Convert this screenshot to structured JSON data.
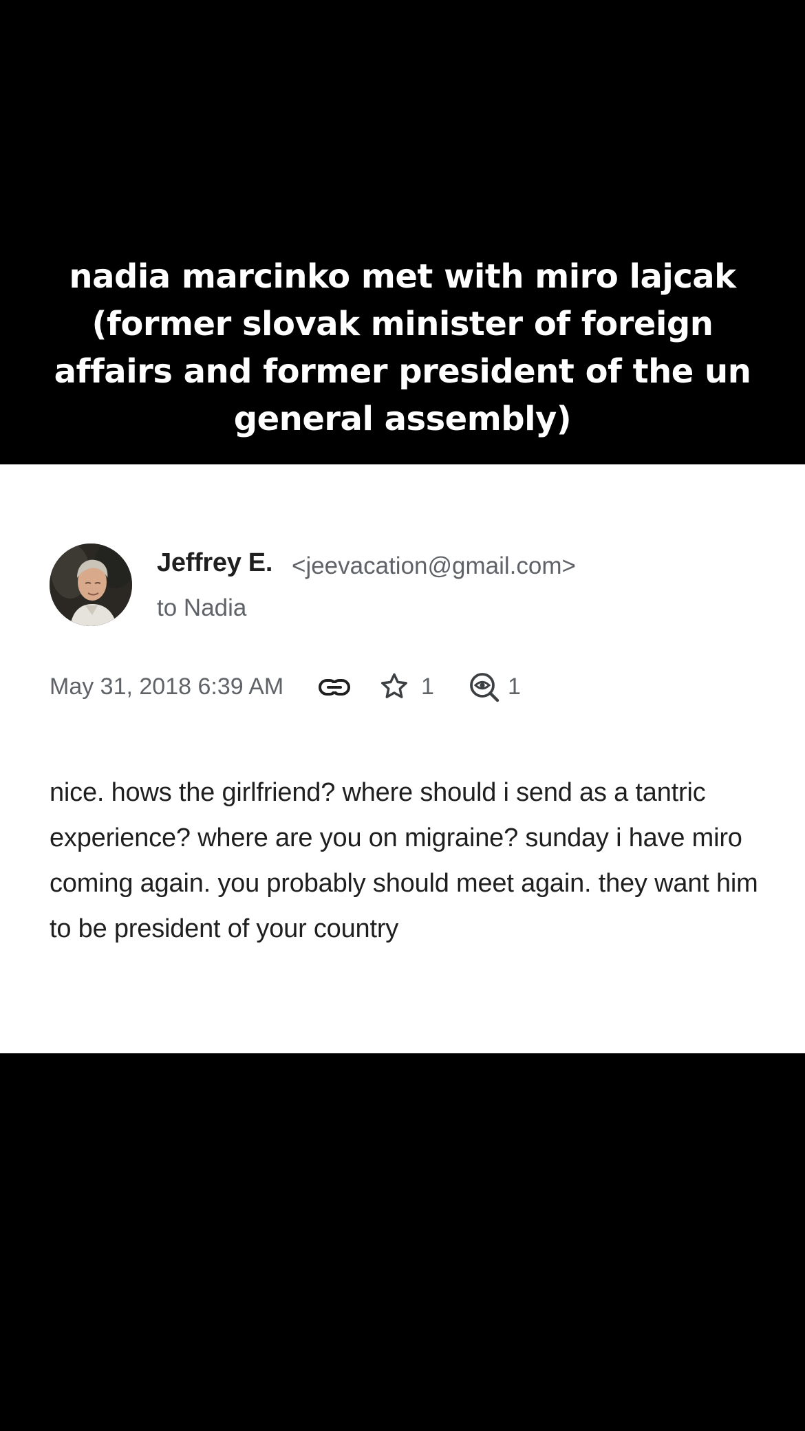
{
  "caption": "nadia marcinko met with miro lajcak (former slovak minister of foreign affairs and former president of the un general assembly)",
  "email": {
    "sender_name": "Jeffrey E.",
    "sender_email": "<jeevacation@gmail.com>",
    "recipient": "to Nadia",
    "date": "May 31, 2018 6:39 AM",
    "star_count": "1",
    "seen_count": "1",
    "body": "nice. hows the girlfriend? where should i send as a tantric experience? where are you on migraine? sunday i have miro coming again. you probably should meet again. they want him to be president of your country"
  },
  "icons": {
    "avatar": "profile-photo",
    "link": "link-icon",
    "star": "star-icon",
    "seen": "eye-search-icon"
  },
  "colors": {
    "background_band": "#000000",
    "card": "#ffffff",
    "primary_text": "#1f1f1f",
    "secondary_text": "#5f6368"
  }
}
